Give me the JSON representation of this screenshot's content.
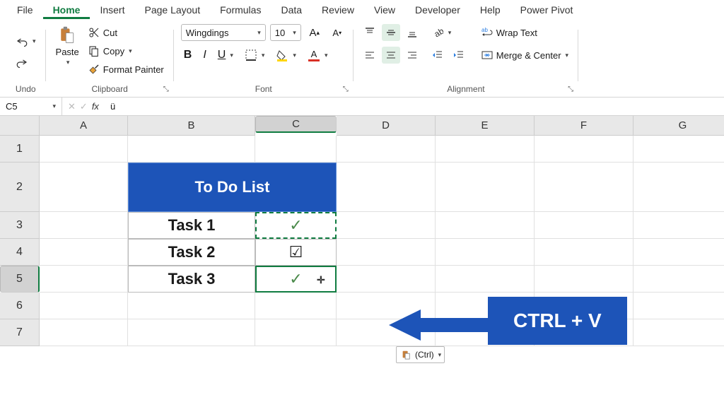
{
  "tabs": {
    "file": "File",
    "home": "Home",
    "insert": "Insert",
    "page_layout": "Page Layout",
    "formulas": "Formulas",
    "data": "Data",
    "review": "Review",
    "view": "View",
    "developer": "Developer",
    "help": "Help",
    "power_pivot": "Power Pivot"
  },
  "ribbon": {
    "undo_label": "Undo",
    "paste_label": "Paste",
    "cut": "Cut",
    "copy": "Copy",
    "format_painter": "Format Painter",
    "clipboard_label": "Clipboard",
    "font_name": "Wingdings",
    "font_size": "10",
    "font_label": "Font",
    "alignment_label": "Alignment",
    "wrap_text": "Wrap Text",
    "merge_center": "Merge & Center"
  },
  "formula_bar": {
    "name_box": "C5",
    "formula": "ü"
  },
  "columns": [
    {
      "letter": "A",
      "width": 125
    },
    {
      "letter": "B",
      "width": 180
    },
    {
      "letter": "C",
      "width": 115
    },
    {
      "letter": "D",
      "width": 140
    },
    {
      "letter": "E",
      "width": 140
    },
    {
      "letter": "F",
      "width": 140
    },
    {
      "letter": "G",
      "width": 140
    }
  ],
  "rows": [
    {
      "n": "1",
      "height": 38
    },
    {
      "n": "2",
      "height": 70
    },
    {
      "n": "3",
      "height": 38
    },
    {
      "n": "4",
      "height": 38
    },
    {
      "n": "5",
      "height": 38
    },
    {
      "n": "6",
      "height": 38
    },
    {
      "n": "7",
      "height": 38
    }
  ],
  "sheet": {
    "title": "To Do List",
    "tasks": [
      "Task 1",
      "Task 2",
      "Task 3"
    ],
    "marks": [
      "✓",
      "☑",
      "✓"
    ]
  },
  "paste_button": "(Ctrl)",
  "callout": "CTRL + V"
}
